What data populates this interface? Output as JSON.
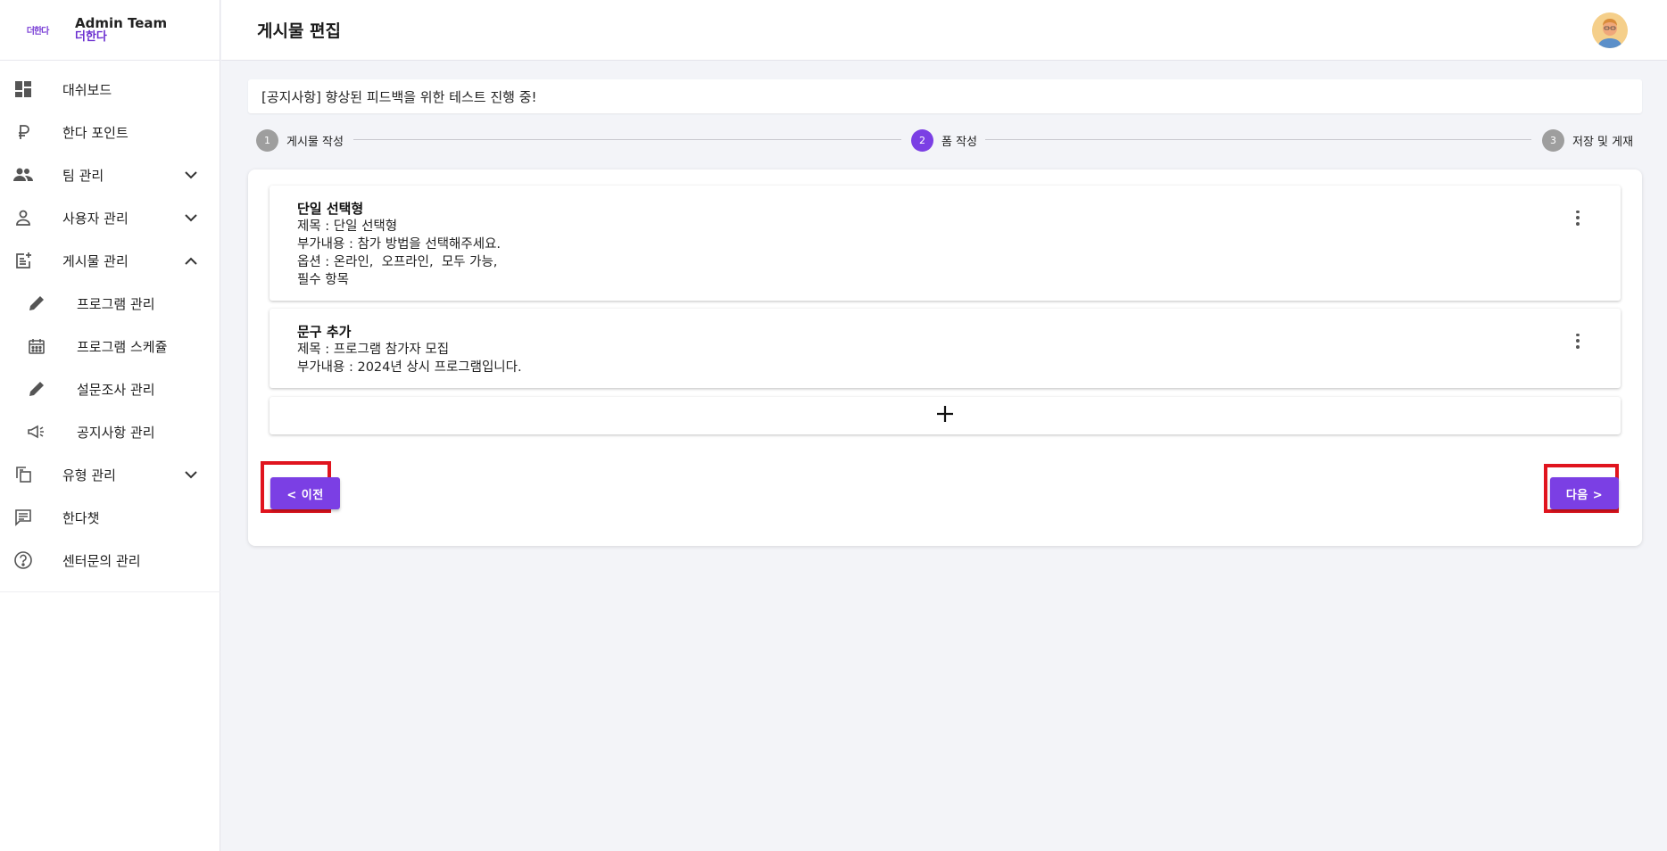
{
  "brand": {
    "logo_text": "더한다",
    "title": "Admin Team",
    "subtitle": "더한다"
  },
  "sidebar": {
    "items": [
      {
        "label": "대쉬보드",
        "icon": "dashboard-icon"
      },
      {
        "label": "한다 포인트",
        "icon": "currency-icon"
      },
      {
        "label": "팀 관리",
        "icon": "people-icon",
        "chevron": "down"
      },
      {
        "label": "사용자 관리",
        "icon": "person-icon",
        "chevron": "down"
      },
      {
        "label": "게시물 관리",
        "icon": "post-add-icon",
        "chevron": "up"
      },
      {
        "label": "프로그램 관리",
        "icon": "pencil-icon",
        "sub": true
      },
      {
        "label": "프로그램 스케쥴",
        "icon": "calendar-icon",
        "sub": true
      },
      {
        "label": "설문조사 관리",
        "icon": "pencil-icon",
        "sub": true
      },
      {
        "label": "공지사항 관리",
        "icon": "megaphone-icon",
        "sub": true
      },
      {
        "label": "유형 관리",
        "icon": "copy-icon",
        "chevron": "down"
      },
      {
        "label": "한다챗",
        "icon": "chat-icon"
      },
      {
        "label": "센터문의 관리",
        "icon": "help-icon"
      }
    ]
  },
  "header": {
    "title": "게시물 편집"
  },
  "notice": {
    "text": "[공지사항] 향상된 피드백을 위한 테스트 진행 중!"
  },
  "stepper": {
    "steps": [
      {
        "number": "1",
        "label": "게시물 작성",
        "active": false
      },
      {
        "number": "2",
        "label": "폼 작성",
        "active": true
      },
      {
        "number": "3",
        "label": "저장 및 게재",
        "active": false
      }
    ]
  },
  "form_fields": [
    {
      "type_label": "단일 선택형",
      "title_line": "제목 : 단일 선택형",
      "desc_line": "부가내용 : 참가 방법을 선택해주세요.",
      "options_line": "옵션 : 온라인,  오프라인,  모두 가능,",
      "required_line": "필수 항목"
    },
    {
      "type_label": "문구 추가",
      "title_line": "제목 : 프로그램 참가자 모집",
      "desc_line": "부가내용 : 2024년 상시 프로그램입니다."
    }
  ],
  "buttons": {
    "prev_label": "< 이전",
    "next_label": "다음 >"
  },
  "colors": {
    "accent": "#7b3fe4",
    "highlight": "#e0141e",
    "background": "#f3f4f8"
  }
}
